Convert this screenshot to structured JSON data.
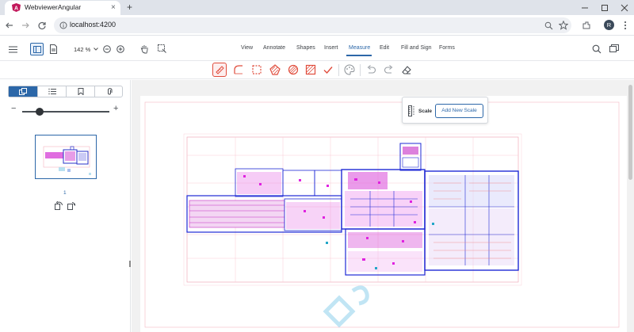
{
  "browser": {
    "tab_title": "WebviewerAngular",
    "url": "localhost:4200",
    "profile_initial": "R",
    "new_tab_symbol": "+",
    "tab_close_symbol": "×"
  },
  "app": {
    "zoom": "142 %",
    "ribbon_tabs": [
      "View",
      "Annotate",
      "Shapes",
      "Insert",
      "Measure",
      "Edit",
      "Fill and Sign",
      "Forms"
    ],
    "active_tab": "Measure"
  },
  "measure_tools": [
    "distance-measure",
    "arc-measure",
    "perimeter-measure",
    "area-measure",
    "ellipse-area-measure",
    "rectangular-area-measure",
    "count-measure",
    "style",
    "undo",
    "redo",
    "eraser"
  ],
  "left_panel": {
    "tabs": [
      "thumbnails",
      "outline",
      "bookmarks",
      "attachments"
    ],
    "active_tab": "thumbnails",
    "zoom_minus": "−",
    "zoom_plus": "+",
    "thumbnail_zoom_level": 0.2,
    "page_number": "1"
  },
  "scale_popup": {
    "label": "Scale",
    "button": "Add New Scale"
  },
  "colors": {
    "accent": "#2c67a8",
    "measure_tool_red": "#e04c3c",
    "drawing_magenta": "#e022e0",
    "drawing_blue": "#1f2ad6",
    "drawing_pink": "#f0a0b0",
    "watermark": "#b9e1f2"
  }
}
